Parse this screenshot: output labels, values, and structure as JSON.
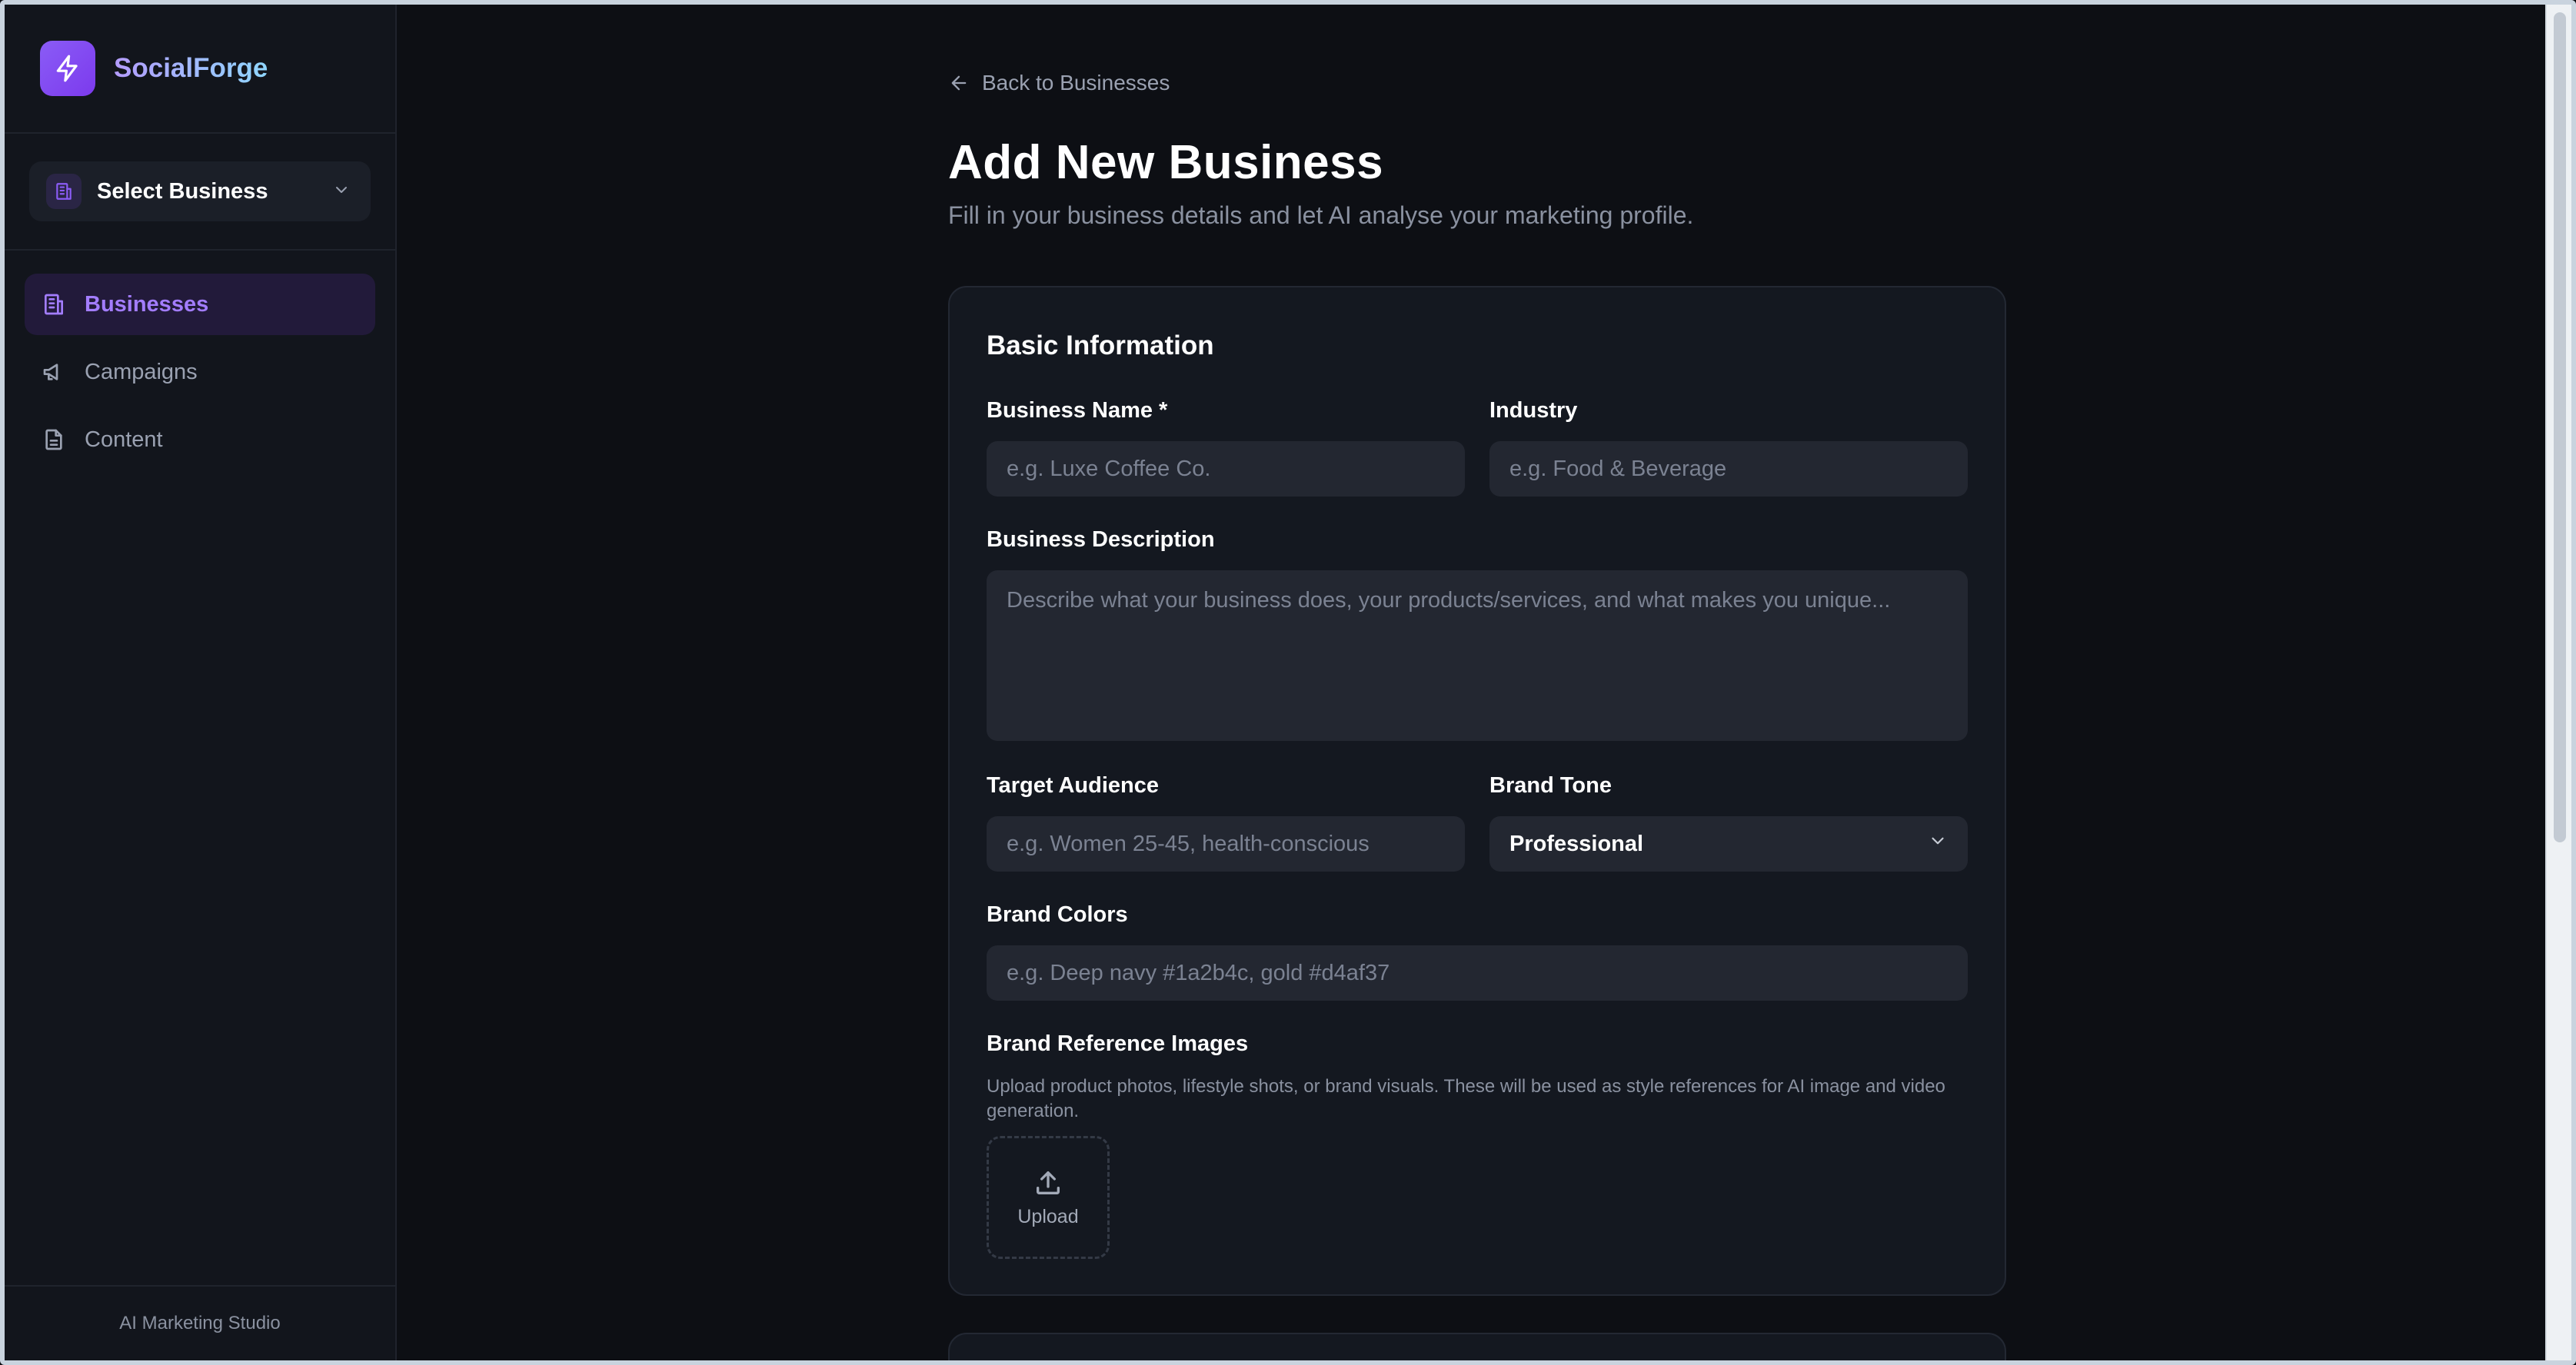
{
  "app": {
    "name": "SocialForge",
    "footer": "AI Marketing Studio",
    "accent": "#8b5cf6"
  },
  "sidebar": {
    "business_select": {
      "label": "Select Business",
      "icon": "building-icon"
    },
    "items": [
      {
        "label": "Businesses",
        "icon": "building-icon",
        "active": true
      },
      {
        "label": "Campaigns",
        "icon": "megaphone-icon",
        "active": false
      },
      {
        "label": "Content",
        "icon": "document-icon",
        "active": false
      }
    ]
  },
  "main": {
    "back_link": "Back to Businesses",
    "title": "Add New Business",
    "subtitle": "Fill in your business details and let AI analyse your marketing profile.",
    "basic_info": {
      "title": "Basic Information",
      "business_name": {
        "label": "Business Name *",
        "placeholder": "e.g. Luxe Coffee Co."
      },
      "industry": {
        "label": "Industry",
        "placeholder": "e.g. Food & Beverage"
      },
      "description": {
        "label": "Business Description",
        "placeholder": "Describe what your business does, your products/services, and what makes you unique..."
      },
      "target_audience": {
        "label": "Target Audience",
        "placeholder": "e.g. Women 25-45, health-conscious"
      },
      "brand_tone": {
        "label": "Brand Tone",
        "value": "Professional"
      },
      "brand_colors": {
        "label": "Brand Colors",
        "placeholder": "e.g. Deep navy #1a2b4c, gold #d4af37"
      },
      "reference_images": {
        "label": "Brand Reference Images",
        "help": "Upload product photos, lifestyle shots, or brand visuals. These will be used as style references for AI image and video generation.",
        "upload_label": "Upload"
      }
    }
  }
}
